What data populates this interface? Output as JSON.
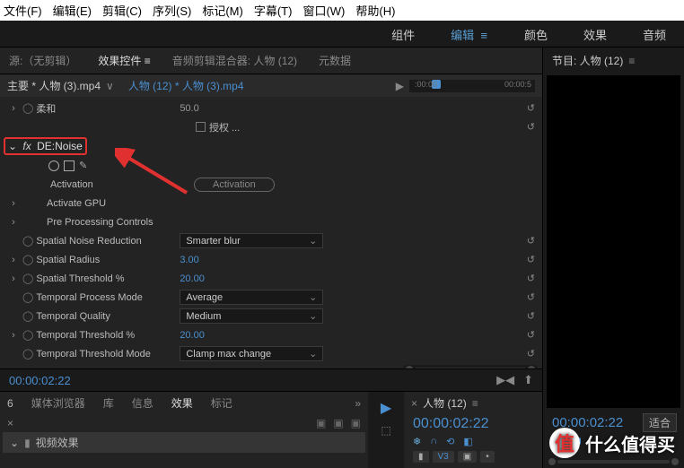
{
  "menubar": [
    "文件(F)",
    "编辑(E)",
    "剪辑(C)",
    "序列(S)",
    "标记(M)",
    "字幕(T)",
    "窗口(W)",
    "帮助(H)"
  ],
  "top_tabs": {
    "assembly": "组件",
    "edit": "编辑",
    "color": "颜色",
    "effect": "效果",
    "audio": "音频"
  },
  "panel_tabs": {
    "source": "源:（无剪辑）",
    "effect_controls": "效果控件",
    "audio_mixer": "音频剪辑混合器: 人物 (12)",
    "metadata": "元数据"
  },
  "effect_header": {
    "main": "主要 * 人物 (3).mp4",
    "sub": "人物 (12) * 人物 (3).mp4"
  },
  "ruler": {
    "t0": ":00:00",
    "t1": "00:00:5"
  },
  "effects": {
    "soft": {
      "label": "柔和",
      "value": "50.0"
    },
    "auth": {
      "label": "授权 ..."
    },
    "denoise": {
      "fx": "fx",
      "name": "DE:Noise"
    },
    "activation": {
      "label": "Activation",
      "btn": "Activation"
    },
    "activate_gpu": "Activate GPU",
    "preproc": "Pre Processing Controls",
    "spatial_noise": {
      "label": "Spatial Noise Reduction",
      "value": "Smarter blur"
    },
    "spatial_radius": {
      "label": "Spatial Radius",
      "value": "3.00"
    },
    "spatial_threshold": {
      "label": "Spatial Threshold %",
      "value": "20.00"
    },
    "temporal_mode": {
      "label": "Temporal Process Mode",
      "value": "Average"
    },
    "temporal_quality": {
      "label": "Temporal Quality",
      "value": "Medium"
    },
    "temporal_threshold": {
      "label": "Temporal Threshold %",
      "value": "20.00"
    },
    "temporal_thresh_mode": {
      "label": "Temporal Threshold Mode",
      "value": "Clamp max change"
    }
  },
  "timecode_main": "00:00:02:22",
  "browser_tabs": {
    "media": "媒体浏览器",
    "lib": "库",
    "info": "信息",
    "effects": "效果",
    "markers": "标记"
  },
  "search_num": "6",
  "video_fx": "视频效果",
  "program": {
    "title": "节目: 人物 (12)",
    "timecode": "00:00:02:22",
    "fit": "适合"
  },
  "sequence": {
    "title": "人物 (12)",
    "timecode": "00:00:02:22",
    "v3": "V3"
  },
  "tool_cursor": "▶",
  "watermark": {
    "char": "值",
    "text": "什么值得买"
  }
}
